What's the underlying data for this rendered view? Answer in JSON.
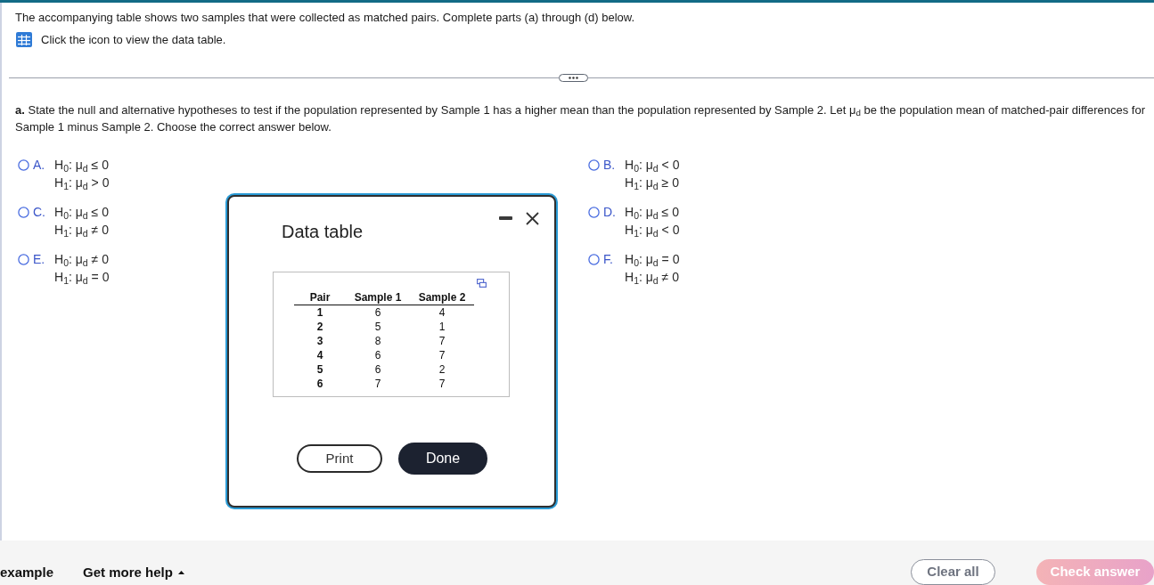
{
  "intro": {
    "text": "The accompanying table shows two samples that were collected as matched pairs. Complete parts (a) through (d) below.",
    "link_text": "Click the icon to view the data table."
  },
  "question": "**a.** State the null and alternative hypotheses to test if the population represented by Sample 1 has a higher mean than the population represented by Sample 2. Let μ$_{d}$ be the population mean of matched-pair differences for Sample 1 minus Sample 2. Choose the correct answer below.",
  "options": [
    {
      "letter": "A.",
      "h0": "H$_{0}$: μ$_{d}$ ≤ 0",
      "h1": "H$_{1}$: μ$_{d}$ > 0",
      "selected": false
    },
    {
      "letter": "B.",
      "h0": "H$_{0}$: μ$_{d}$ < 0",
      "h1": "H$_{1}$: μ$_{d}$ ≥ 0",
      "selected": false
    },
    {
      "letter": "C.",
      "h0": "H$_{0}$: μ$_{d}$ ≤ 0",
      "h1": "H$_{1}$: μ$_{d}$ ≠ 0",
      "selected": false
    },
    {
      "letter": "D.",
      "h0": "H$_{0}$: μ$_{d}$ ≤ 0",
      "h1": "H$_{1}$: μ$_{d}$ < 0",
      "selected": false
    },
    {
      "letter": "E.",
      "h0": "H$_{0}$: μ$_{d}$ ≠ 0",
      "h1": "H$_{1}$: μ$_{d}$ = 0",
      "selected": false
    },
    {
      "letter": "F.",
      "h0": "H$_{0}$: μ$_{d}$ = 0",
      "h1": "H$_{1}$: μ$_{d}$ ≠ 0",
      "selected": false
    }
  ],
  "data_table": {
    "title": "Data table",
    "columns": [
      "Pair",
      "Sample 1",
      "Sample 2"
    ],
    "rows": [
      [
        "1",
        "6",
        "4"
      ],
      [
        "2",
        "5",
        "1"
      ],
      [
        "3",
        "8",
        "7"
      ],
      [
        "4",
        "6",
        "7"
      ],
      [
        "5",
        "6",
        "2"
      ],
      [
        "6",
        "7",
        "7"
      ]
    ],
    "buttons": [
      {
        "label": "Print",
        "kind": "outline"
      },
      {
        "label": "Done",
        "kind": "solid"
      }
    ]
  },
  "footer": {
    "links": [
      {
        "label": "example",
        "kind": "link"
      },
      {
        "label": "Get more help",
        "kind": "menu"
      }
    ],
    "buttons": [
      {
        "label": "Clear all",
        "kind": "outline",
        "disabled": false
      },
      {
        "label": "Check answer",
        "kind": "primary",
        "disabled": true
      }
    ]
  }
}
